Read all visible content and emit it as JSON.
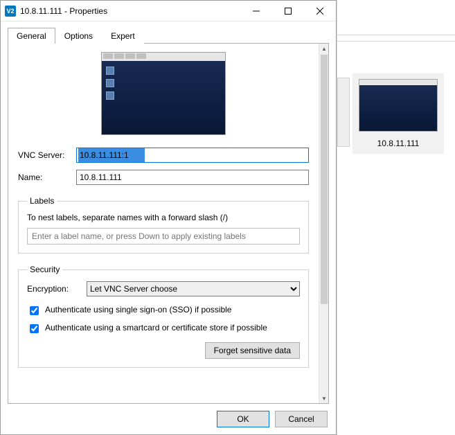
{
  "window": {
    "title": "10.8.11.111 - Properties",
    "app_icon_text": "V2"
  },
  "tabs": {
    "general": "General",
    "options": "Options",
    "expert": "Expert"
  },
  "fields": {
    "vnc_server_label": "VNC Server:",
    "vnc_server_value": "10.8.11.111:1",
    "name_label": "Name:",
    "name_value": "10.8.11.111"
  },
  "labels_group": {
    "legend": "Labels",
    "help": "To nest labels, separate names with a forward slash (/)",
    "placeholder": "Enter a label name, or press Down to apply existing labels"
  },
  "security_group": {
    "legend": "Security",
    "encryption_label": "Encryption:",
    "encryption_value": "Let VNC Server choose",
    "sso_label": "Authenticate using single sign-on (SSO) if possible",
    "smartcard_label": "Authenticate using a smartcard or certificate store if possible",
    "forget_button": "Forget sensitive data"
  },
  "buttons": {
    "ok": "OK",
    "cancel": "Cancel"
  },
  "connection_card": {
    "caption": "10.8.11.111"
  }
}
